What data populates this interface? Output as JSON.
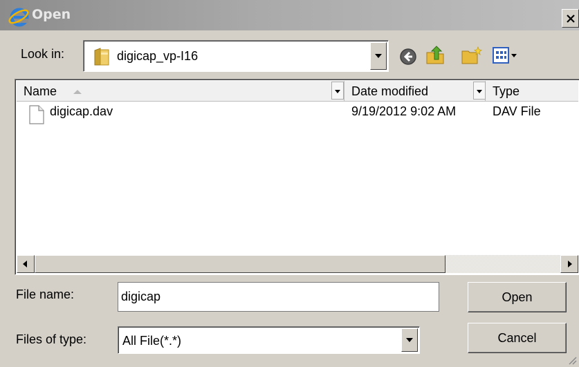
{
  "window": {
    "title": "Open",
    "close_glyph": "x"
  },
  "look_in": {
    "label": "Look in:",
    "value": "digicap_vp-I16",
    "icon": "folder-icon"
  },
  "toolbar": {
    "icons": [
      "back-icon",
      "up-folder-icon",
      "new-folder-icon",
      "view-menu-icon"
    ]
  },
  "file_list": {
    "columns": [
      "Name",
      "Date modified",
      "Type"
    ],
    "rows": [
      {
        "name": "digicap.dav",
        "date_modified": "9/19/2012 9:02 AM",
        "type": "DAV File",
        "icon": "file-icon"
      }
    ]
  },
  "file_name": {
    "label": "File name:",
    "value": "digicap"
  },
  "file_type": {
    "label": "Files of type:",
    "value": "All File(*.*)"
  },
  "buttons": {
    "open": "Open",
    "cancel": "Cancel"
  },
  "colors": {
    "dialog_bg": "#d4d0c8",
    "titlebar_start": "#8c8c8c",
    "titlebar_end": "#bfbfbf"
  }
}
